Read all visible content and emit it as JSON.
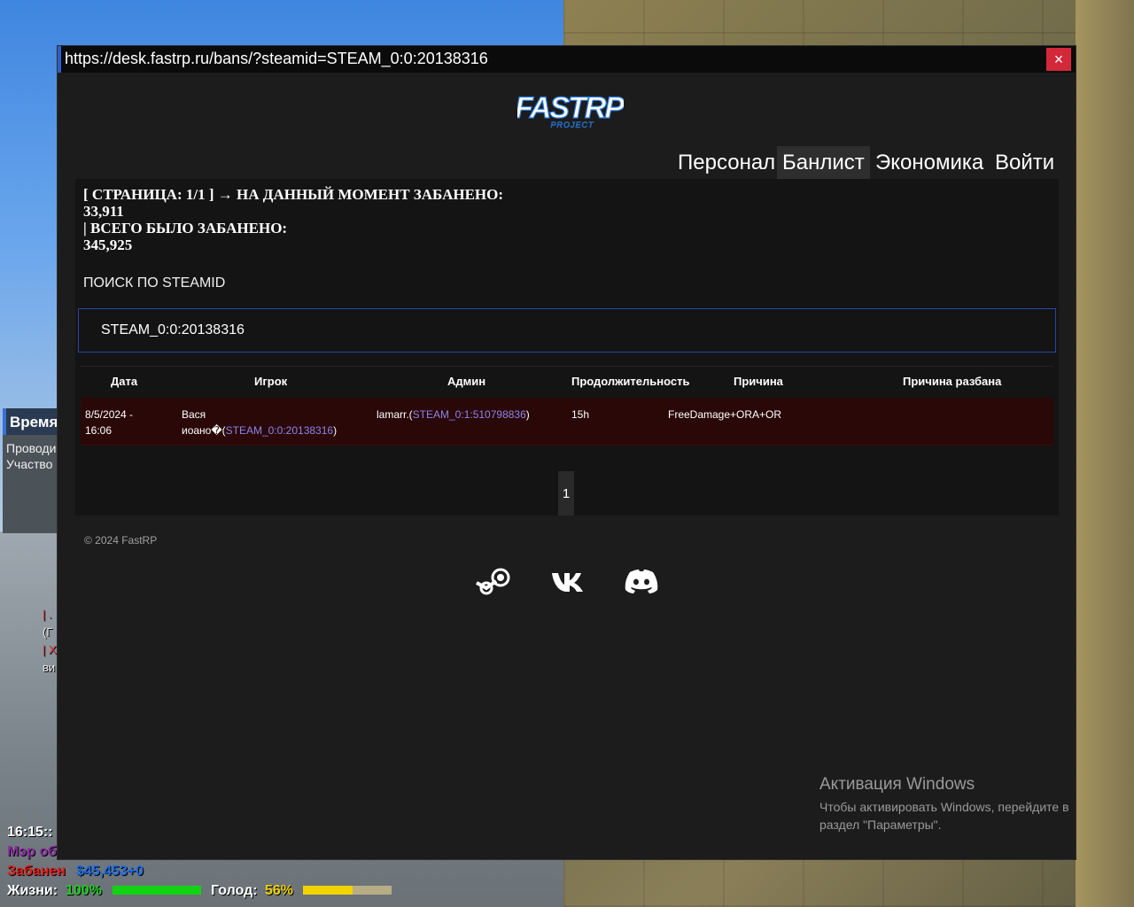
{
  "window": {
    "url": "https://desk.fastrp.ru/bans/?steamid=STEAM_0:0:20138316",
    "close_symbol": "×"
  },
  "site": {
    "logo_text": "FASTRP",
    "logo_subtext": "PROJECT",
    "nav": [
      {
        "label": "Персонал",
        "active": false
      },
      {
        "label": "Банлист",
        "active": true
      },
      {
        "label": "Экономика",
        "active": false
      },
      {
        "label": "Войти",
        "active": false
      }
    ]
  },
  "stats": {
    "line1": "[ СТРАНИЦА: 1/1 ] → НА ДАННЫЙ МОМЕНТ ЗАБАНЕНО:",
    "current_banned": "33,911",
    "line3": "| ВСЕГО БЫЛО ЗАБАНЕНО:",
    "total_banned": "345,925"
  },
  "search": {
    "label": "ПОИСК ПО STEAMID",
    "value": "STEAM_0:0:20138316"
  },
  "table": {
    "headers": [
      "Дата",
      "Игрок",
      "Админ",
      "Продолжительность",
      "Причина",
      "Причина разбана"
    ],
    "rows": [
      {
        "date_line1": "8/5/2024 -",
        "date_line2": "16:06",
        "player_name_line1": "Вася",
        "player_name_line2": "иоано�(",
        "player_steamid": "STEAM_0:0:20138316",
        "player_close": ")",
        "admin_name": "lamarr.(",
        "admin_steamid": "STEAM_0:1:510798836",
        "admin_close": ")",
        "duration": "15h",
        "reason": "FreeDamage+ORA+OR",
        "unban_reason": ""
      }
    ]
  },
  "pagination": {
    "current": "1"
  },
  "footer": {
    "copyright": "© 2024 FastRP",
    "social_icons": [
      "steam-icon",
      "vk-icon",
      "discord-icon"
    ]
  },
  "windows_activation": {
    "title": "Активация Windows",
    "description": "Чтобы активировать Windows, перейдите в раздел \"Параметры\"."
  },
  "game_hud": {
    "panel_title": "Время",
    "panel_line1": "Проводи",
    "panel_line2": "Участво",
    "chat": [
      "| .",
      "(Г",
      "| Х",
      "ви"
    ],
    "time": "16:15::",
    "job": "Мэр об",
    "status": "Забанен",
    "money": "$45,453+0",
    "health_label": "Жизни:",
    "health_value": "100%",
    "health_fraction": 1.0,
    "hunger_label": "Голод:",
    "hunger_value": "56%",
    "hunger_fraction": 0.56
  },
  "colors": {
    "accent": "#2f5ec8",
    "ban_row": "#2a0808",
    "link": "#8b86e8",
    "close": "#d3283a"
  }
}
